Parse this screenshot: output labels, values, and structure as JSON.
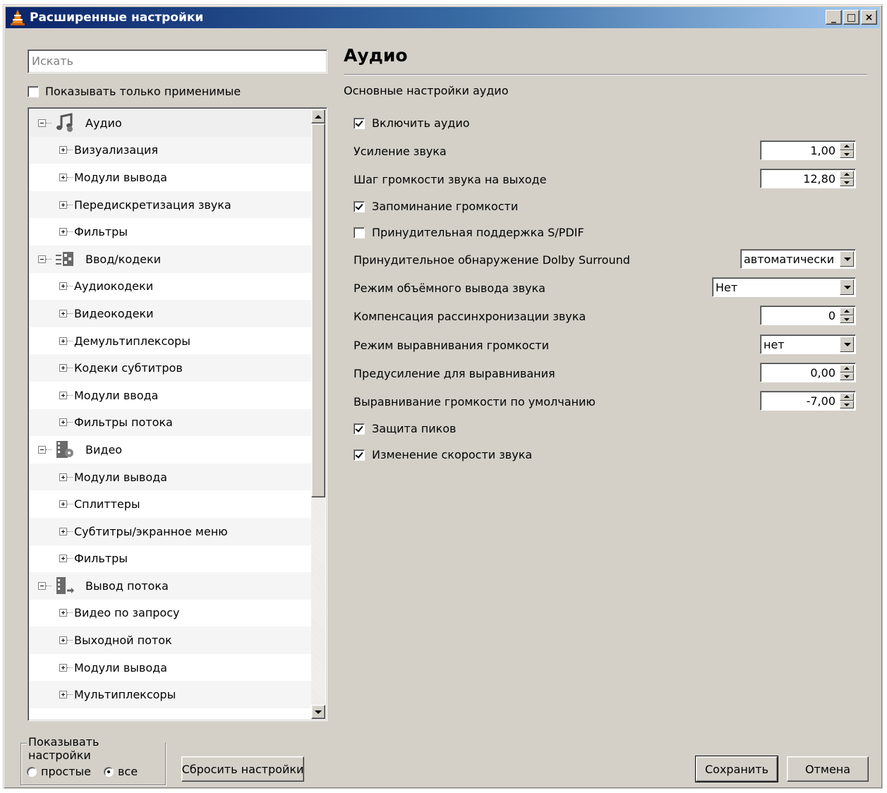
{
  "window": {
    "title": "Расширенные настройки",
    "controls": [
      "_",
      "□",
      "×"
    ]
  },
  "sidebar": {
    "search_placeholder": "Искать",
    "only_applicable_label": "Показывать только применимые",
    "only_applicable_checked": false,
    "tree": [
      {
        "type": "cat",
        "label": "Аудио",
        "icon": "music-note-icon",
        "expanded": true,
        "selected": true
      },
      {
        "type": "sub",
        "label": "Визуализация"
      },
      {
        "type": "sub",
        "label": "Модули вывода"
      },
      {
        "type": "sub",
        "label": "Передискретизация звука"
      },
      {
        "type": "sub",
        "label": "Фильтры"
      },
      {
        "type": "cat",
        "label": "Ввод/кодеки",
        "icon": "input-codecs-icon",
        "expanded": true
      },
      {
        "type": "sub",
        "label": "Аудиокодеки"
      },
      {
        "type": "sub",
        "label": "Видеокодеки"
      },
      {
        "type": "sub",
        "label": "Демультиплексоры"
      },
      {
        "type": "sub",
        "label": "Кодеки субтитров"
      },
      {
        "type": "sub",
        "label": "Модули ввода"
      },
      {
        "type": "sub",
        "label": "Фильтры потока"
      },
      {
        "type": "cat",
        "label": "Видео",
        "icon": "video-film-icon",
        "expanded": true
      },
      {
        "type": "sub",
        "label": "Модули вывода"
      },
      {
        "type": "sub",
        "label": "Сплиттеры"
      },
      {
        "type": "sub",
        "label": "Субтитры/экранное меню"
      },
      {
        "type": "sub",
        "label": "Фильтры"
      },
      {
        "type": "cat",
        "label": "Вывод потока",
        "icon": "stream-output-icon",
        "expanded": true
      },
      {
        "type": "sub",
        "label": "Видео по запросу"
      },
      {
        "type": "sub",
        "label": "Выходной поток"
      },
      {
        "type": "sub",
        "label": "Модули вывода"
      },
      {
        "type": "sub",
        "label": "Мультиплексоры"
      }
    ]
  },
  "panel": {
    "title": "Аудио",
    "subtitle": "Основные настройки аудио",
    "enable_audio": {
      "label": "Включить аудио",
      "checked": true
    },
    "gain": {
      "label": "Усиление звука",
      "value": "1,00"
    },
    "volume_step": {
      "label": "Шаг громкости звука на выходе",
      "value": "12,80"
    },
    "remember_volume": {
      "label": "Запоминание громкости",
      "checked": true
    },
    "force_spdif": {
      "label": "Принудительная поддержка S/PDIF",
      "checked": false
    },
    "dolby": {
      "label": "Принудительное обнаружение Dolby Surround",
      "value": "автоматически"
    },
    "stereo_mode": {
      "label": "Режим объёмного вывода звука",
      "value": "Нет"
    },
    "desync": {
      "label": "Компенсация рассинхронизации звука",
      "value": "0"
    },
    "replaygain_mode": {
      "label": "Режим выравнивания громкости",
      "value": "нет"
    },
    "replaygain_preamp": {
      "label": "Предусиление для выравнивания",
      "value": "0,00"
    },
    "replaygain_default": {
      "label": "Выравнивание громкости по умолчанию",
      "value": "-7,00"
    },
    "peak_protection": {
      "label": "Защита пиков",
      "checked": true
    },
    "time_stretch": {
      "label": "Изменение скорости звука",
      "checked": true
    }
  },
  "footer": {
    "show_settings_label": "Показывать настройки",
    "simple_label": "простые",
    "all_label": "все",
    "selected": "все",
    "reset_label": "Сбросить настройки",
    "save_label": "Сохранить",
    "cancel_label": "Отмена"
  },
  "colors": {
    "titlebar_start": "#0a246a",
    "titlebar_end": "#a6caf0",
    "face": "#d4d0c8",
    "vlc_orange": "#f58c1e"
  }
}
